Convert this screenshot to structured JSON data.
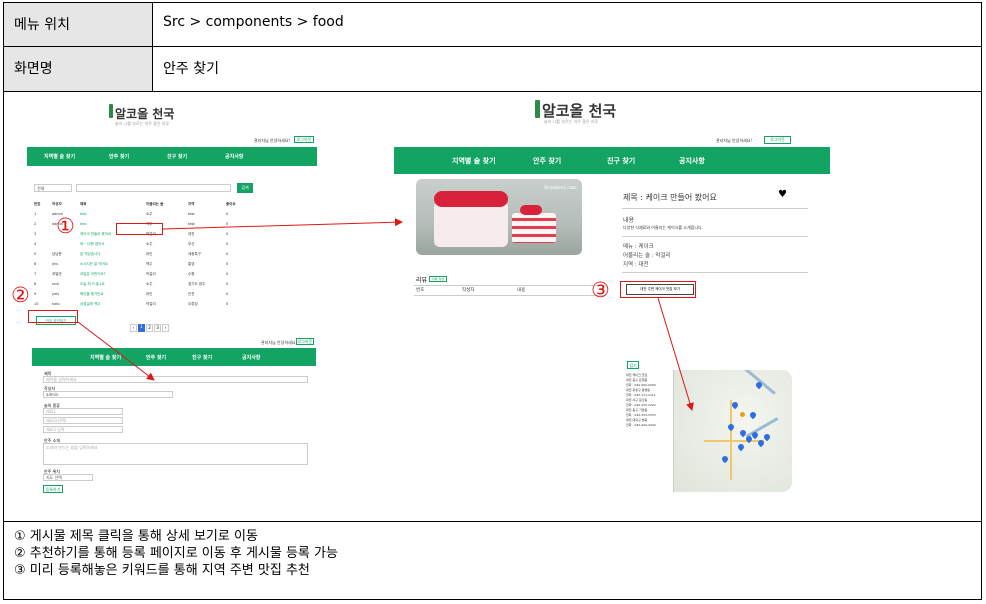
{
  "header": {
    "menu_label": "메뉴 위치",
    "menu_value": "Src > components > food",
    "screen_label": "화면명",
    "screen_value": "안주 찾기"
  },
  "app": {
    "brand": "알코올 천국",
    "brand_sub": "술이 나를 부르는 아주 좋은 하루",
    "admin_greeting": "관리자님 안녕하세요!",
    "logout": "로그아웃",
    "nav": [
      "지역별 술 찾기",
      "안주 찾기",
      "친구 찾기",
      "공지사항"
    ]
  },
  "list_screen": {
    "filter_option": "전체",
    "search_button": "검색",
    "columns": [
      "번호",
      "작성자",
      "제목",
      "어울리는 술",
      "지역",
      "좋아요"
    ],
    "rows": [
      [
        "1",
        "admin",
        "test",
        "소주",
        "test",
        "0"
      ],
      [
        "2",
        "admin",
        "test",
        "맥주",
        "test",
        "0"
      ],
      [
        "3",
        "",
        "케이크 만들어 봤어요",
        "막걸리",
        "대전",
        "0"
      ],
      [
        "4",
        "",
        "와~ 다행 접어서",
        "소주",
        "부산",
        "0"
      ],
      [
        "5",
        "냠냠준",
        "잘 먹었습니다",
        "와인",
        "세종특구",
        "0"
      ],
      [
        "6",
        "jinu",
        "소시지전 잘 먹어요",
        "맥주",
        "통영",
        "0"
      ],
      [
        "7",
        "과일맛",
        "과일은 어떤가요?",
        "막걸리",
        "수원",
        "0"
      ],
      [
        "8",
        "nick",
        "오늘 뭐 드셨나요",
        "소주",
        "경기도 광주",
        "0"
      ],
      [
        "9",
        "yeis",
        "해산물 했거든요",
        "와인",
        "인천",
        "0"
      ],
      [
        "10",
        "kato",
        "삼겹살에 맥주",
        "막걸리",
        "오류성",
        "0"
      ]
    ],
    "recommend_button": "안주 추천하기",
    "pages": [
      "‹",
      "1",
      "2",
      "3",
      "›"
    ]
  },
  "register_screen": {
    "title_label": "제목",
    "title_placeholder": "제목을 입력하세요",
    "writer_label": "작성자",
    "writer_value": "admin",
    "drink_label": "술의 종류",
    "ingredient_placeholders": [
      "재료1",
      "재료2(선택)",
      "재료3 입력"
    ],
    "content_label": "안주 소개",
    "content_placeholder": "소개와 만드는 법을 입력하세요",
    "region_label": "안주 위치",
    "region_value": "지도 선택",
    "submit_button": "등록하기"
  },
  "detail_screen": {
    "image_caption": "Strawberry cake",
    "title": "제목 : 케이크 만들어 봤어요",
    "content_label": "내용",
    "content": "다양한 식재료와 어울리는 케이크를 소개합니다.",
    "menu": "메뉴 : 케이크",
    "drink": "어울리는 술 : 막걸리",
    "region": "지역 : 대전",
    "review_label": "리뷰",
    "review_button": "리뷰 작성",
    "review_columns": [
      "번호",
      "작성자",
      "내용"
    ],
    "nearby_button": "대전 주변 케이크 맛집 보기",
    "close_button": "접기",
    "map_list": [
      "대전 케이크 맛집",
      "대전 중구 은행동",
      "전화 : 042-000-0000",
      "대전 유성구 봉명동",
      "전화 : 042-111-1111",
      "대전 서구 둔산동",
      "전화 : 042-222-2222",
      "대전 동구 가양동",
      "전화 : 042-333-3333",
      "대전 대덕구 법동",
      "전화 : 042-444-4444"
    ]
  },
  "markers": [
    "①",
    "②",
    "③"
  ],
  "notes": [
    "① 게시물 제목 클릭을 통해 상세 보기로 이동",
    "② 추천하기를 통해 등록 페이지로 이동 후 게시물 등록 가능",
    "③ 미리 등록해놓은 키워드를 통해 지역 주변 맛집 추천"
  ],
  "colors": {
    "accent": "#13a463",
    "annotation": "#e01616",
    "label_bg": "#e6e6e6"
  }
}
